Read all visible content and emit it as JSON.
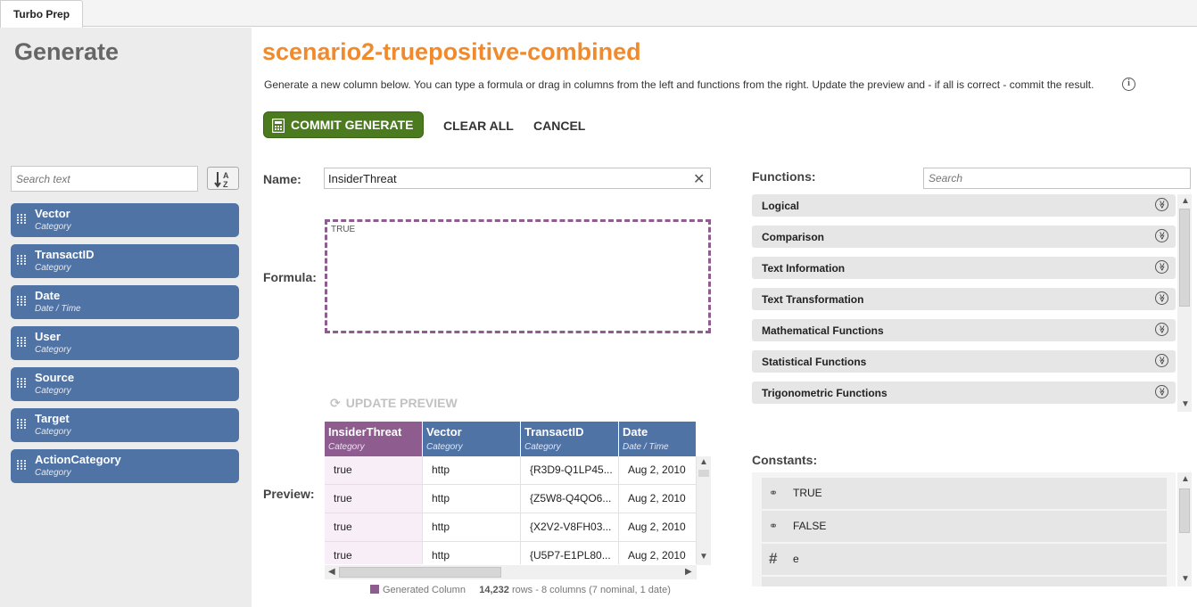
{
  "tabbar": {
    "tab": "Turbo Prep"
  },
  "left": {
    "title": "Generate",
    "search_placeholder": "Search text",
    "columns": [
      {
        "name": "Vector",
        "type": "Category"
      },
      {
        "name": "TransactID",
        "type": "Category"
      },
      {
        "name": "Date",
        "type": "Date / Time"
      },
      {
        "name": "User",
        "type": "Category"
      },
      {
        "name": "Source",
        "type": "Category"
      },
      {
        "name": "Target",
        "type": "Category"
      },
      {
        "name": "ActionCategory",
        "type": "Category"
      }
    ]
  },
  "header": {
    "title": "scenario2-truepositive-combined",
    "description": "Generate a new column below.  You can type a formula or drag in columns from the left and functions from the right.  Update the preview and - if all is correct - commit the result."
  },
  "actions": {
    "commit": "COMMIT GENERATE",
    "clear": "CLEAR ALL",
    "cancel": "CANCEL"
  },
  "form": {
    "name_label": "Name:",
    "name_value": "InsiderThreat",
    "formula_label": "Formula:",
    "formula_value": "TRUE",
    "update_preview": "UPDATE PREVIEW",
    "preview_label": "Preview:"
  },
  "preview": {
    "columns": [
      {
        "name": "InsiderThreat",
        "type": "Category"
      },
      {
        "name": "Vector",
        "type": "Category"
      },
      {
        "name": "TransactID",
        "type": "Category"
      },
      {
        "name": "Date",
        "type": "Date / Time"
      }
    ],
    "rows": [
      [
        "true",
        "http",
        "{R3D9-Q1LP45...",
        "Aug 2, 2010"
      ],
      [
        "true",
        "http",
        "{Z5W8-Q4QO6...",
        "Aug 2, 2010"
      ],
      [
        "true",
        "http",
        "{X2V2-V8FH03...",
        "Aug 2, 2010"
      ],
      [
        "true",
        "http",
        "{U5P7-E1PL80...",
        "Aug 2, 2010"
      ]
    ],
    "legend": "Generated Column",
    "rows_count": "14,232",
    "summary": "rows - 8 columns (7 nominal, 1 date)"
  },
  "functions": {
    "label": "Functions:",
    "search_placeholder": "Search",
    "groups": [
      "Logical",
      "Comparison",
      "Text Information",
      "Text Transformation",
      "Mathematical Functions",
      "Statistical Functions",
      "Trigonometric Functions"
    ]
  },
  "constants": {
    "label": "Constants:",
    "items": [
      {
        "icon": "logical-icon",
        "label": "TRUE"
      },
      {
        "icon": "logical-icon",
        "label": "FALSE"
      },
      {
        "icon": "number-icon",
        "label": "e"
      }
    ]
  },
  "colors": {
    "accent": "#f08a2c",
    "column": "#4f73a5",
    "generated": "#8e5c8e",
    "commit": "#4c7a1f"
  }
}
